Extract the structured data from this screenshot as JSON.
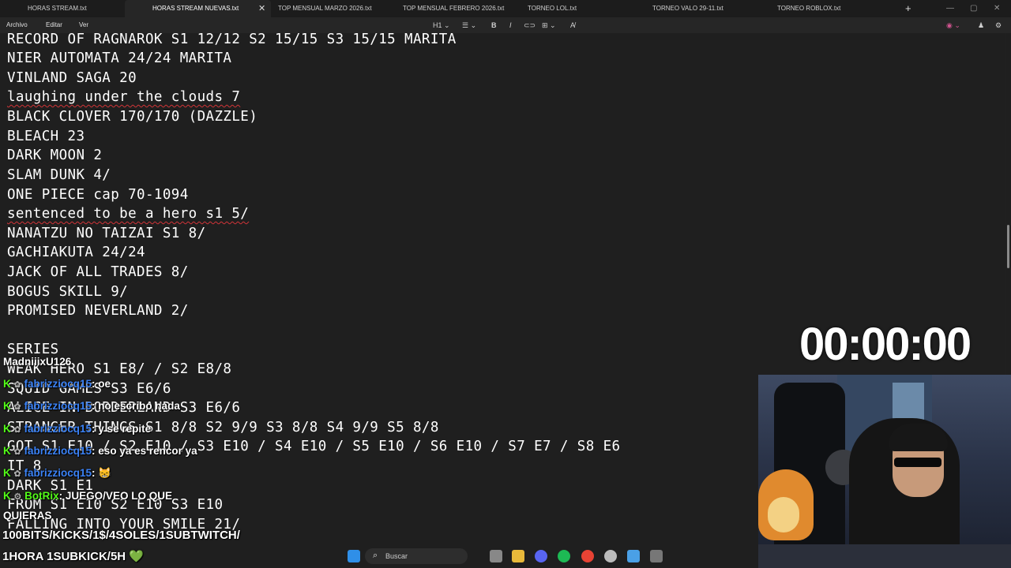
{
  "tabs": [
    {
      "label": "HORAS STREAM.txt",
      "active": false
    },
    {
      "label": "HORAS STREAM NUEVAS.txt",
      "active": true
    },
    {
      "label": "TOP MENSUAL MARZO 2026.txt",
      "active": false
    },
    {
      "label": "TOP MENSUAL FEBRERO 2026.txt",
      "active": false
    },
    {
      "label": "TORNEO LOL.txt",
      "active": false
    },
    {
      "label": "TORNEO VALO 29-11.txt",
      "active": false
    },
    {
      "label": "TORNEO ROBLOX.txt",
      "active": false
    }
  ],
  "menu": {
    "archivo": "Archivo",
    "editar": "Editar",
    "ver": "Ver"
  },
  "toolbar": {
    "heading": "H1",
    "bold": "B",
    "italic": "I"
  },
  "editor_lines": [
    "RECORD OF RAGNAROK S1 12/12 S2 15/15 S3 15/15 MARITA",
    "NIER AUTOMATA 24/24 MARITA",
    "VINLAND SAGA 20",
    "laughing under the clouds 7",
    "BLACK CLOVER 170/170 (DAZZLE)",
    "BLEACH 23",
    "DARK MOON 2",
    "SLAM DUNK 4/",
    "ONE PIECE cap 70-1094",
    "sentenced to be a hero s1 5/",
    "NANATZU NO TAIZAI S1 8/",
    "GACHIAKUTA 24/24",
    "JACK OF ALL TRADES 8/",
    "BOGUS SKILL 9/",
    "PROMISED NEVERLAND 2/",
    "",
    "SERIES",
    "WEAK HERO S1 E8/ / S2 E8/8",
    "SQUID GAMES S3 E6/6",
    "ALICE IN BORDERLAND S3 E6/6",
    "STRANGER THINGS S1 8/8 S2 9/9 S3 8/8 S4 9/9 S5 8/8",
    "GOT S1 E10 / S2 E10 / S3 E10 / S4 E10 / S5 E10 / S6 E10 / S7 E7 / S8 E6",
    "IT 8",
    "DARK S1 E1",
    "FROM S1 E10 S2 E10 S3 E10",
    "FALLING INTO YOUR SMILE 21/"
  ],
  "timer": "00:00:00",
  "chat": [
    {
      "user": "fabrizziocq15",
      "message": "oe"
    },
    {
      "user": "fabrizziocq15",
      "message": "no escribo nada"
    },
    {
      "user": "fabrizziocq15",
      "message": "y se repite"
    },
    {
      "user": "fabrizziocq15",
      "message": "eso ya es rencor ya"
    },
    {
      "user": "fabrizziocq15",
      "message": "😸"
    },
    {
      "user": "BotRix",
      "message": "JUEGO/VEO LO QUE"
    }
  ],
  "chat_partial_top": "MadniiixU126",
  "chat_wrap": "QUIERAS",
  "bottom_line1": "100BITS/KICKS/1$/4SOLES/1SUBTWITCH/",
  "bottom_line2": "1HORA 1SUBKICK/5H 💚",
  "taskbar": {
    "search_label": "Buscar"
  },
  "colors": {
    "accent_kick": "#53fc18",
    "username": "#3b82f6",
    "spell_error": "#d13438"
  }
}
